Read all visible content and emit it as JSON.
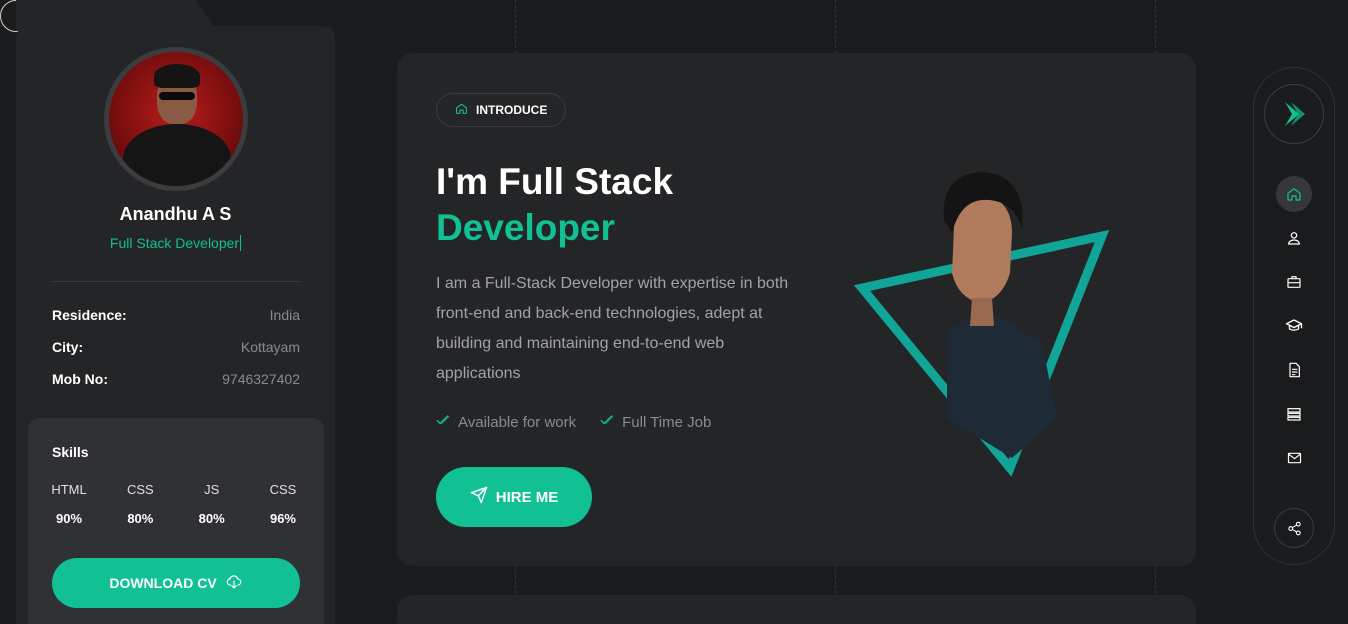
{
  "profile": {
    "name": "Anandhu A S",
    "role": "Full Stack Developer",
    "info": [
      {
        "label": "Residence:",
        "value": "India"
      },
      {
        "label": "City:",
        "value": "Kottayam"
      },
      {
        "label": "Mob No:",
        "value": "9746327402"
      }
    ],
    "skills_title": "Skills",
    "skills": [
      {
        "name": "HTML",
        "percent": "90%"
      },
      {
        "name": "CSS",
        "percent": "80%"
      },
      {
        "name": "JS",
        "percent": "80%"
      },
      {
        "name": "CSS",
        "percent": "96%"
      }
    ],
    "download_label": "DOWNLOAD CV"
  },
  "hero": {
    "badge": "INTRODUCE",
    "title_line1": "I'm Full Stack",
    "title_line2": "Developer",
    "description": "I am a Full-Stack Developer with expertise in both front-end and back-end technologies, adept at building and maintaining end-to-end web applications",
    "tags": [
      "Available for work",
      "Full Time Job"
    ],
    "hire_label": "HIRE ME"
  },
  "nav": {
    "items": [
      "home-icon",
      "user-icon",
      "briefcase-icon",
      "graduation-cap-icon",
      "document-icon",
      "layers-icon",
      "mail-icon"
    ],
    "share": "share-icon"
  },
  "colors": {
    "accent": "#11c193",
    "background": "#1a1b1d",
    "card": "#242527"
  }
}
